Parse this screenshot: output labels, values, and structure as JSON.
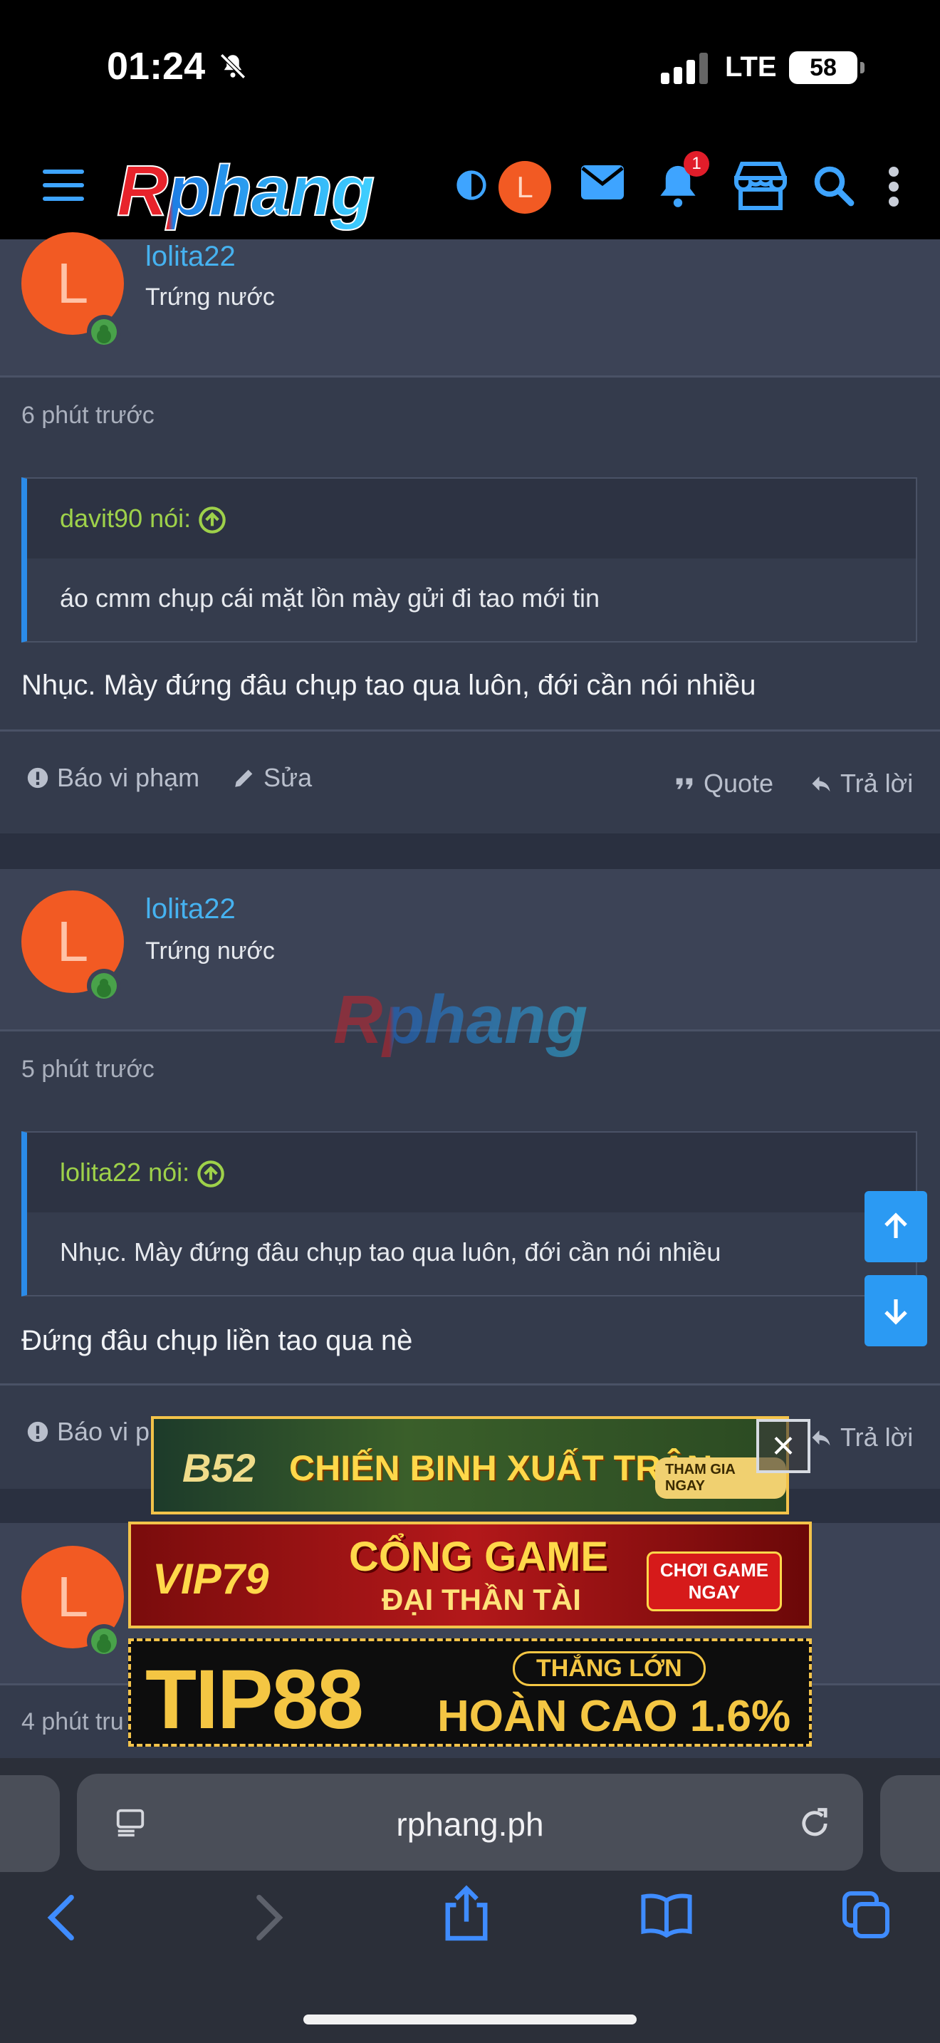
{
  "status_bar": {
    "time": "01:24",
    "network": "LTE",
    "battery": "58"
  },
  "header": {
    "logo": "Rphang",
    "avatar_letter": "L",
    "notification_count": "1"
  },
  "watermark": "Rphang",
  "posts": [
    {
      "username": "lolita22",
      "user_title": "Trứng nước",
      "avatar_letter": "L",
      "time_ago": "6 phút trước",
      "quote_author": "davit90 nói:",
      "quote_text": "áo cmm chụp cái mặt lồn mày gửi đi tao mới tin",
      "message": "Nhục. Mày đứng đâu chụp tao qua luôn, đới cần nói nhiều",
      "actions": {
        "report": "Báo vi phạm",
        "edit": "Sửa",
        "quote": "Quote",
        "reply": "Trả lời"
      }
    },
    {
      "username": "lolita22",
      "user_title": "Trứng nước",
      "avatar_letter": "L",
      "time_ago": "5 phút trước",
      "quote_author": "lolita22 nói:",
      "quote_text": "Nhục. Mày đứng đâu chụp tao qua luôn, đới cần nói nhiều",
      "message": "Đứng đâu chụp liền tao qua nè",
      "actions": {
        "report": "Báo vi p",
        "reply": "Trả lời"
      }
    },
    {
      "avatar_letter": "L",
      "time_ago": "4 phút tru"
    }
  ],
  "ads": [
    {
      "brand": "B52",
      "headline": "CHIẾN BINH XUẤT TRẬN",
      "cta": "THAM GIA NGAY"
    },
    {
      "brand": "VIP79",
      "headline": "CỔNG GAME",
      "subline": "ĐẠI THẦN TÀI",
      "cta": "CHƠI GAME NGAY"
    },
    {
      "brand": "TIP88",
      "headline": "THẮNG LỚN",
      "subline": "HOÀN CAO 1.6%"
    }
  ],
  "ad_close": "×",
  "browser": {
    "url": "rphang.ph"
  },
  "colors": {
    "accent": "#2b9af3",
    "username": "#46b2f0",
    "quote_author": "#9ed14a",
    "avatar": "#f25a23"
  }
}
